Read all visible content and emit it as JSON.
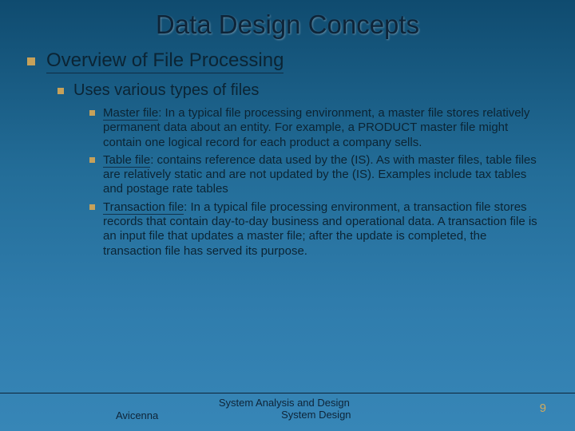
{
  "title": "Data Design Concepts",
  "heading": "Overview of File Processing",
  "subheading": "Uses various types of files",
  "items": [
    {
      "term": "Master file",
      "body": ": In a typical file processing environment, a master file stores relatively permanent data about an entity. For example, a PRODUCT master file might contain one logical record for each product a company sells."
    },
    {
      "term": "Table file",
      "body": ": contains reference data used by the (IS). As with master files, table files are relatively static and are not updated by the (IS). Examples include tax tables and postage rate tables"
    },
    {
      "term": "Transaction file",
      "body": ": In a typical file processing environment, a transaction file stores records that contain day-to-day business and operational data. A transaction file is an input file that updates a master file; after the update is completed, the transaction file has served its purpose."
    }
  ],
  "footer": {
    "line1": "System Analysis and Design",
    "line2": "System Design",
    "left": "Avicenna",
    "page": "9"
  }
}
